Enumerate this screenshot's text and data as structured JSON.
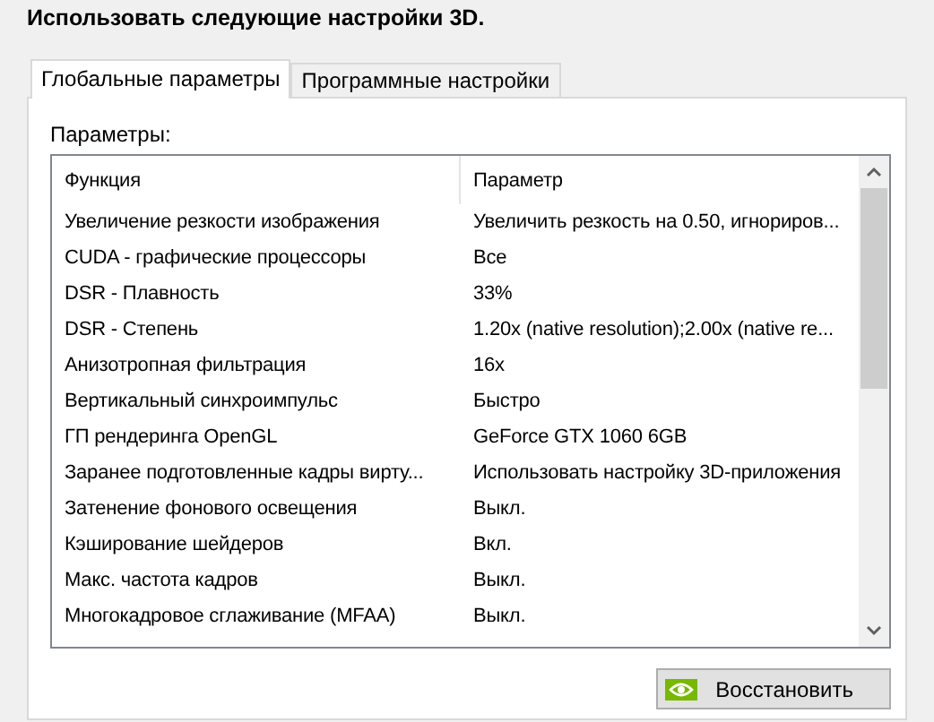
{
  "heading": "Использовать следующие настройки 3D.",
  "tabs": [
    {
      "label": "Глобальные параметры",
      "selected": true
    },
    {
      "label": "Программные настройки",
      "selected": false
    }
  ],
  "settings_label": "Параметры:",
  "table": {
    "columns": [
      "Функция",
      "Параметр"
    ],
    "rows": [
      [
        "Увеличение резкости изображения",
        "Увеличить резкость на 0.50, игнориров..."
      ],
      [
        "CUDA - графические процессоры",
        "Все"
      ],
      [
        "DSR - Плавность",
        "33%"
      ],
      [
        "DSR - Степень",
        "1.20x (native resolution);2.00x (native re..."
      ],
      [
        "Анизотропная фильтрация",
        "16x"
      ],
      [
        "Вертикальный синхроимпульс",
        "Быстро"
      ],
      [
        "ГП рендеринга OpenGL",
        "GeForce GTX 1060 6GB"
      ],
      [
        "Заранее подготовленные кадры вирту...",
        "Использовать настройку 3D-приложения"
      ],
      [
        "Затенение фонового освещения",
        "Выкл."
      ],
      [
        "Кэширование шейдеров",
        "Вкл."
      ],
      [
        "Макс. частота кадров",
        "Выкл."
      ],
      [
        "Многокадровое сглаживание (MFAA)",
        "Выкл."
      ]
    ]
  },
  "restore_button": "Восстановить"
}
